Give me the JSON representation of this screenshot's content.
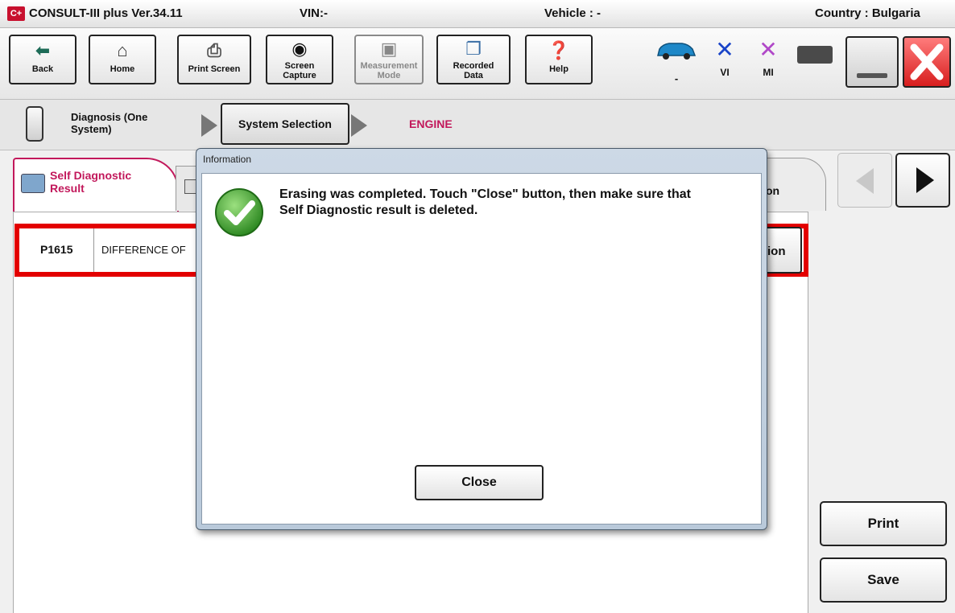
{
  "titlebar": {
    "logo": "C+",
    "app": "CONSULT-III plus  Ver.34.11",
    "vin": "VIN:-",
    "vehicle": "Vehicle : -",
    "country": "Country : Bulgaria"
  },
  "toolbar": {
    "back": "Back",
    "home": "Home",
    "print_screen": "Print Screen",
    "screen_capture": "Screen Capture",
    "measurement_mode": "Measurement Mode",
    "recorded_data": "Recorded Data",
    "help": "Help",
    "status_car_label": "-",
    "status_vi_label": "VI",
    "status_mi_label": "MI"
  },
  "breadcrumb": {
    "step1": "Diagnosis (One System)",
    "step2": "System Selection",
    "step3": "ENGINE"
  },
  "tabs": {
    "self_diag": "Self Diagnostic Result",
    "partial_right": "on"
  },
  "dtc_row": {
    "code": "P1615",
    "description": "DIFFERENCE OF",
    "button_partial": "tion"
  },
  "side_buttons": {
    "print": "Print",
    "save": "Save"
  },
  "dialog": {
    "title": "Information",
    "message": "Erasing was completed. Touch \"Close\" button, then make sure that Self Diagnostic result is deleted.",
    "close": "Close"
  },
  "colors": {
    "accent_red": "#e30000",
    "tab_text": "#c2185b",
    "engine_text": "#c2185b",
    "success_green": "#43a82f"
  }
}
